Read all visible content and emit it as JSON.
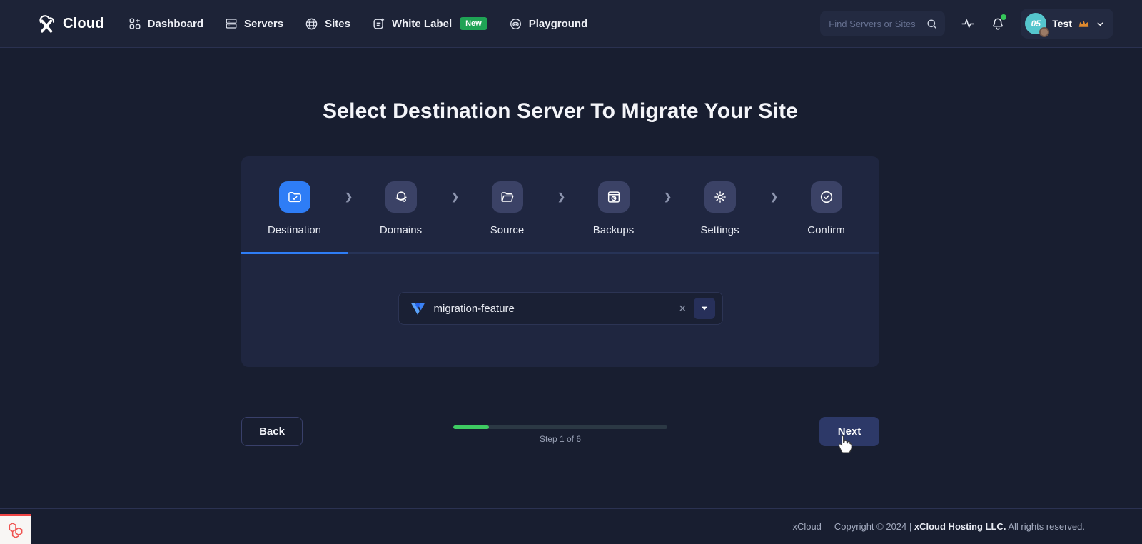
{
  "nav": {
    "brand": "Cloud",
    "items": [
      {
        "label": "Dashboard"
      },
      {
        "label": "Servers"
      },
      {
        "label": "Sites"
      },
      {
        "label": "White Label",
        "badge": "New"
      },
      {
        "label": "Playground"
      }
    ],
    "search_placeholder": "Find Servers or Sites",
    "user": {
      "avatar_text": "05",
      "name": "Test"
    }
  },
  "page": {
    "title": "Select Destination Server To Migrate Your Site"
  },
  "wizard": {
    "steps": [
      {
        "label": "Destination",
        "icon": "folder-check-icon",
        "active": true
      },
      {
        "label": "Domains",
        "icon": "domain-globe-icon",
        "active": false
      },
      {
        "label": "Source",
        "icon": "folder-open-icon",
        "active": false
      },
      {
        "label": "Backups",
        "icon": "backup-window-icon",
        "active": false
      },
      {
        "label": "Settings",
        "icon": "gear-icon",
        "active": false
      },
      {
        "label": "Confirm",
        "icon": "check-circle-icon",
        "active": false
      }
    ],
    "select": {
      "value": "migration-feature",
      "provider_icon": "vultr-icon"
    },
    "back_label": "Back",
    "next_label": "Next",
    "progress": {
      "step": 1,
      "total": 6,
      "label": "Step 1 of 6"
    }
  },
  "footer": {
    "brand": "xCloud",
    "copyright": "Copyright © 2024 |",
    "company": "xCloud Hosting LLC.",
    "rights": "All rights reserved."
  },
  "colors": {
    "accent_blue": "#2e7df6",
    "progress_green": "#3ecb62",
    "badge_green": "#1fa355",
    "crown_orange": "#e08a2e",
    "avatar_teal": "#55c6cd"
  }
}
